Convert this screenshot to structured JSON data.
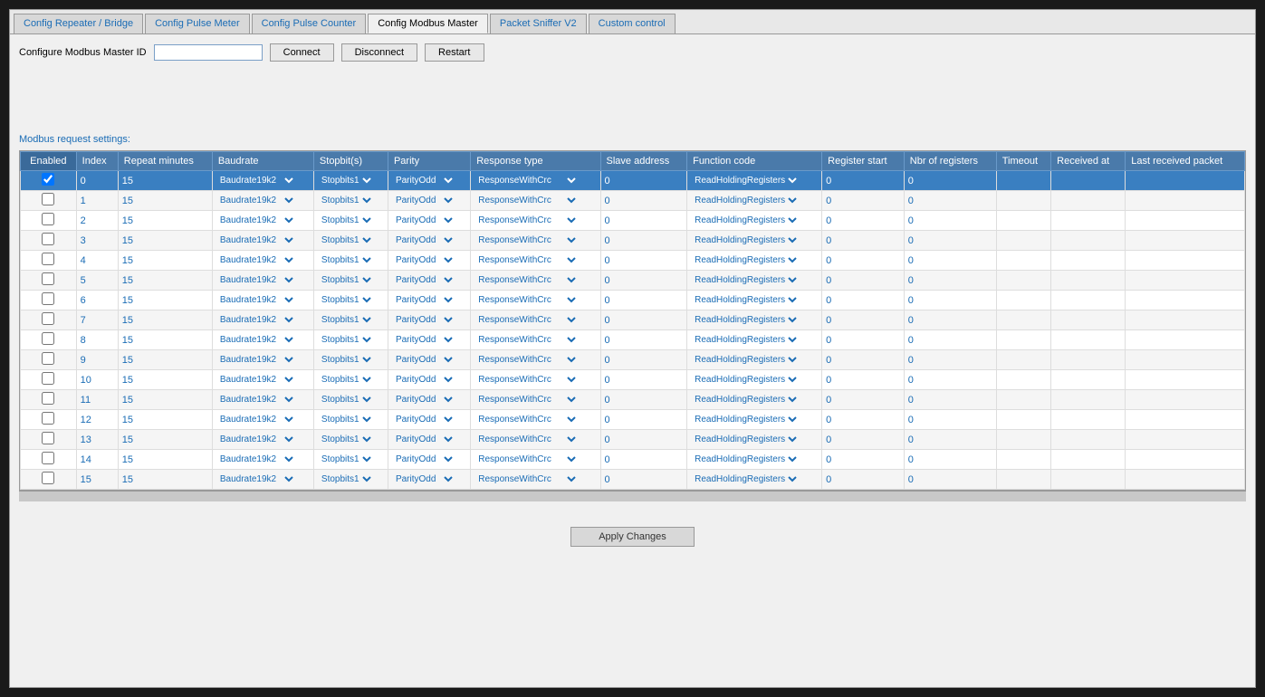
{
  "tabs": [
    {
      "label": "Config Repeater / Bridge",
      "active": false
    },
    {
      "label": "Config Pulse Meter",
      "active": false
    },
    {
      "label": "Config Pulse Counter",
      "active": false
    },
    {
      "label": "Config Modbus Master",
      "active": true
    },
    {
      "label": "Packet Sniffer V2",
      "active": false
    },
    {
      "label": "Custom control",
      "active": false
    }
  ],
  "config": {
    "label": "Configure Modbus Master ID",
    "input_value": "",
    "input_placeholder": "",
    "connect_label": "Connect",
    "disconnect_label": "Disconnect",
    "restart_label": "Restart"
  },
  "section_label": "Modbus request settings:",
  "table": {
    "columns": [
      {
        "key": "enabled",
        "label": "Enabled"
      },
      {
        "key": "index",
        "label": "Index"
      },
      {
        "key": "repeat_minutes",
        "label": "Repeat minutes"
      },
      {
        "key": "baudrate",
        "label": "Baudrate"
      },
      {
        "key": "stopbits",
        "label": "Stopbit(s)"
      },
      {
        "key": "parity",
        "label": "Parity"
      },
      {
        "key": "response_type",
        "label": "Response type"
      },
      {
        "key": "slave_address",
        "label": "Slave address"
      },
      {
        "key": "function_code",
        "label": "Function code"
      },
      {
        "key": "register_start",
        "label": "Register start"
      },
      {
        "key": "nbr_registers",
        "label": "Nbr of registers"
      },
      {
        "key": "timeout",
        "label": "Timeout"
      },
      {
        "key": "received_at",
        "label": "Received at"
      },
      {
        "key": "last_received_packet",
        "label": "Last received packet"
      }
    ],
    "rows": [
      {
        "index": "0",
        "repeat": "15",
        "baudrate": "Baudrate19k2",
        "stopbits": "Stopbits1",
        "parity": "ParityOdd",
        "response_type": "ResponseWithCrc",
        "slave_address": "0",
        "function_code": "ReadHoldingRegisters",
        "register_start": "0",
        "nbr_registers": "0",
        "timeout": "",
        "received_at": "",
        "last_received_packet": "",
        "selected": true
      },
      {
        "index": "1",
        "repeat": "15",
        "baudrate": "Baudrate19k2",
        "stopbits": "Stopbits1",
        "parity": "ParityOdd",
        "response_type": "ResponseWithCrc",
        "slave_address": "0",
        "function_code": "ReadHoldingRegisters",
        "register_start": "0",
        "nbr_registers": "0",
        "timeout": "",
        "received_at": "",
        "last_received_packet": "",
        "selected": false
      },
      {
        "index": "2",
        "repeat": "15",
        "baudrate": "Baudrate19k2",
        "stopbits": "Stopbits1",
        "parity": "ParityOdd",
        "response_type": "ResponseWithCrc",
        "slave_address": "0",
        "function_code": "ReadHoldingRegisters",
        "register_start": "0",
        "nbr_registers": "0",
        "timeout": "",
        "received_at": "",
        "last_received_packet": "",
        "selected": false
      },
      {
        "index": "3",
        "repeat": "15",
        "baudrate": "Baudrate19k2",
        "stopbits": "Stopbits1",
        "parity": "ParityOdd",
        "response_type": "ResponseWithCrc",
        "slave_address": "0",
        "function_code": "ReadHoldingRegisters",
        "register_start": "0",
        "nbr_registers": "0",
        "timeout": "",
        "received_at": "",
        "last_received_packet": "",
        "selected": false
      },
      {
        "index": "4",
        "repeat": "15",
        "baudrate": "Baudrate19k2",
        "stopbits": "Stopbits1",
        "parity": "ParityOdd",
        "response_type": "ResponseWithCrc",
        "slave_address": "0",
        "function_code": "ReadHoldingRegisters",
        "register_start": "0",
        "nbr_registers": "0",
        "timeout": "",
        "received_at": "",
        "last_received_packet": "",
        "selected": false
      },
      {
        "index": "5",
        "repeat": "15",
        "baudrate": "Baudrate19k2",
        "stopbits": "Stopbits1",
        "parity": "ParityOdd",
        "response_type": "ResponseWithCrc",
        "slave_address": "0",
        "function_code": "ReadHoldingRegisters",
        "register_start": "0",
        "nbr_registers": "0",
        "timeout": "",
        "received_at": "",
        "last_received_packet": "",
        "selected": false
      },
      {
        "index": "6",
        "repeat": "15",
        "baudrate": "Baudrate19k2",
        "stopbits": "Stopbits1",
        "parity": "ParityOdd",
        "response_type": "ResponseWithCrc",
        "slave_address": "0",
        "function_code": "ReadHoldingRegisters",
        "register_start": "0",
        "nbr_registers": "0",
        "timeout": "",
        "received_at": "",
        "last_received_packet": "",
        "selected": false
      },
      {
        "index": "7",
        "repeat": "15",
        "baudrate": "Baudrate19k2",
        "stopbits": "Stopbits1",
        "parity": "ParityOdd",
        "response_type": "ResponseWithCrc",
        "slave_address": "0",
        "function_code": "ReadHoldingRegisters",
        "register_start": "0",
        "nbr_registers": "0",
        "timeout": "",
        "received_at": "",
        "last_received_packet": "",
        "selected": false
      },
      {
        "index": "8",
        "repeat": "15",
        "baudrate": "Baudrate19k2",
        "stopbits": "Stopbits1",
        "parity": "ParityOdd",
        "response_type": "ResponseWithCrc",
        "slave_address": "0",
        "function_code": "ReadHoldingRegisters",
        "register_start": "0",
        "nbr_registers": "0",
        "timeout": "",
        "received_at": "",
        "last_received_packet": "",
        "selected": false
      },
      {
        "index": "9",
        "repeat": "15",
        "baudrate": "Baudrate19k2",
        "stopbits": "Stopbits1",
        "parity": "ParityOdd",
        "response_type": "ResponseWithCrc",
        "slave_address": "0",
        "function_code": "ReadHoldingRegisters",
        "register_start": "0",
        "nbr_registers": "0",
        "timeout": "",
        "received_at": "",
        "last_received_packet": "",
        "selected": false
      },
      {
        "index": "10",
        "repeat": "15",
        "baudrate": "Baudrate19k2",
        "stopbits": "Stopbits1",
        "parity": "ParityOdd",
        "response_type": "ResponseWithCrc",
        "slave_address": "0",
        "function_code": "ReadHoldingRegisters",
        "register_start": "0",
        "nbr_registers": "0",
        "timeout": "",
        "received_at": "",
        "last_received_packet": "",
        "selected": false
      },
      {
        "index": "11",
        "repeat": "15",
        "baudrate": "Baudrate19k2",
        "stopbits": "Stopbits1",
        "parity": "ParityOdd",
        "response_type": "ResponseWithCrc",
        "slave_address": "0",
        "function_code": "ReadHoldingRegisters",
        "register_start": "0",
        "nbr_registers": "0",
        "timeout": "",
        "received_at": "",
        "last_received_packet": "",
        "selected": false
      },
      {
        "index": "12",
        "repeat": "15",
        "baudrate": "Baudrate19k2",
        "stopbits": "Stopbits1",
        "parity": "ParityOdd",
        "response_type": "ResponseWithCrc",
        "slave_address": "0",
        "function_code": "ReadHoldingRegisters",
        "register_start": "0",
        "nbr_registers": "0",
        "timeout": "",
        "received_at": "",
        "last_received_packet": "",
        "selected": false
      },
      {
        "index": "13",
        "repeat": "15",
        "baudrate": "Baudrate19k2",
        "stopbits": "Stopbits1",
        "parity": "ParityOdd",
        "response_type": "ResponseWithCrc",
        "slave_address": "0",
        "function_code": "ReadHoldingRegisters",
        "register_start": "0",
        "nbr_registers": "0",
        "timeout": "",
        "received_at": "",
        "last_received_packet": "",
        "selected": false
      },
      {
        "index": "14",
        "repeat": "15",
        "baudrate": "Baudrate19k2",
        "stopbits": "Stopbits1",
        "parity": "ParityOdd",
        "response_type": "ResponseWithCrc",
        "slave_address": "0",
        "function_code": "ReadHoldingRegisters",
        "register_start": "0",
        "nbr_registers": "0",
        "timeout": "",
        "received_at": "",
        "last_received_packet": "",
        "selected": false
      },
      {
        "index": "15",
        "repeat": "15",
        "baudrate": "Baudrate19k2",
        "stopbits": "Stopbits1",
        "parity": "ParityOdd",
        "response_type": "ResponseWithCrc",
        "slave_address": "0",
        "function_code": "ReadHoldingRegisters",
        "register_start": "0",
        "nbr_registers": "0",
        "timeout": "",
        "received_at": "",
        "last_received_packet": "",
        "selected": false
      }
    ]
  },
  "footer": {
    "apply_label": "Apply Changes"
  }
}
